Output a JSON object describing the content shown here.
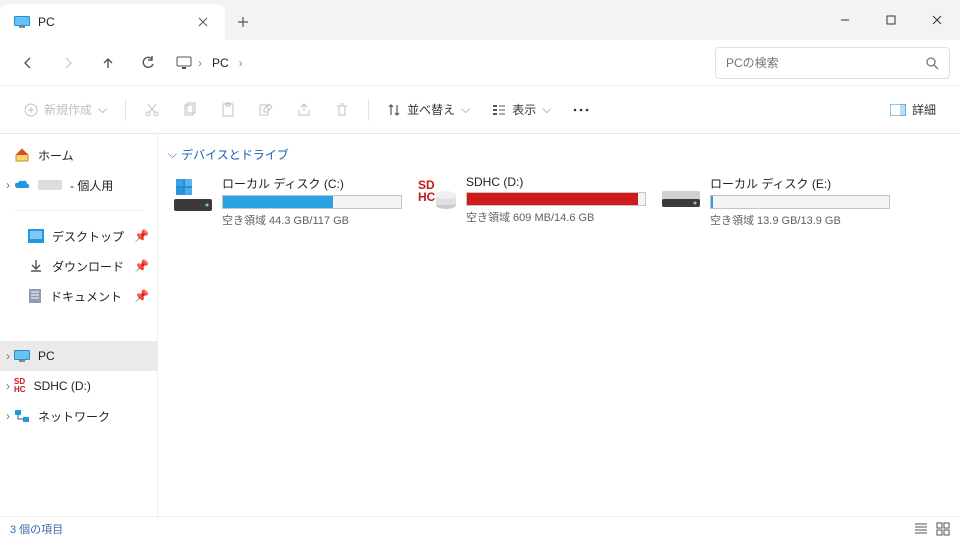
{
  "tab": {
    "title": "PC"
  },
  "breadcrumb": {
    "pc": "PC"
  },
  "search": {
    "placeholder": "PCの検索"
  },
  "toolbar": {
    "new_label": "新規作成",
    "sort_label": "並べ替え",
    "view_label": "表示",
    "details_label": "詳細"
  },
  "sidebar": {
    "home": "ホーム",
    "personal": " - 個人用",
    "desktop": "デスクトップ",
    "downloads": "ダウンロード",
    "documents": "ドキュメント",
    "pc": "PC",
    "sdhc": "SDHC (D:)",
    "network": "ネットワーク"
  },
  "group": {
    "devices": "デバイスとドライブ"
  },
  "drives": [
    {
      "name": "ローカル ディスク (C:)",
      "free": "空き領域 44.3 GB/117 GB",
      "fill_pct": 62,
      "color": "#2aa1e0"
    },
    {
      "name": "SDHC (D:)",
      "free": "空き領域 609 MB/14.6 GB",
      "fill_pct": 96,
      "color": "#d11a1a"
    },
    {
      "name": "ローカル ディスク (E:)",
      "free": "空き領域 13.9 GB/13.9 GB",
      "fill_pct": 1,
      "color": "#2aa1e0"
    }
  ],
  "status": {
    "text": "3 個の項目"
  }
}
